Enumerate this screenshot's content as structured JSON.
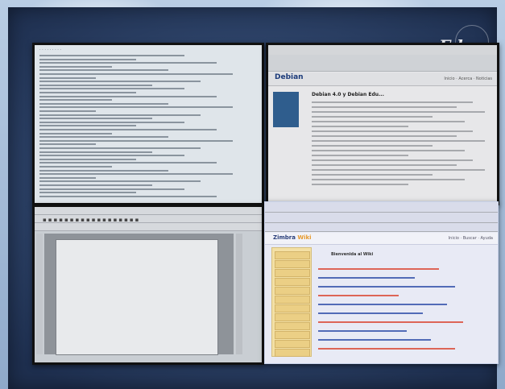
{
  "brand": {
    "logo_text": "Edge"
  },
  "windows": {
    "browser_top": {
      "site_title": "Debian",
      "article_title": "Debian 4.0 y Debian Edu...",
      "nav": "Inicio  ·  Acerca  ·  Noticias"
    },
    "browser_bottom": {
      "logo_main": "Zimbra",
      "logo_accent": "Wiki",
      "nav": "Inicio  ·  Buscar  ·  Ayuda",
      "heading": "Bienvenida al Wiki"
    }
  },
  "colors": {
    "desktop": "#2c4166",
    "accent_link": "#2c4ba8",
    "accent_red": "#d9442f"
  }
}
